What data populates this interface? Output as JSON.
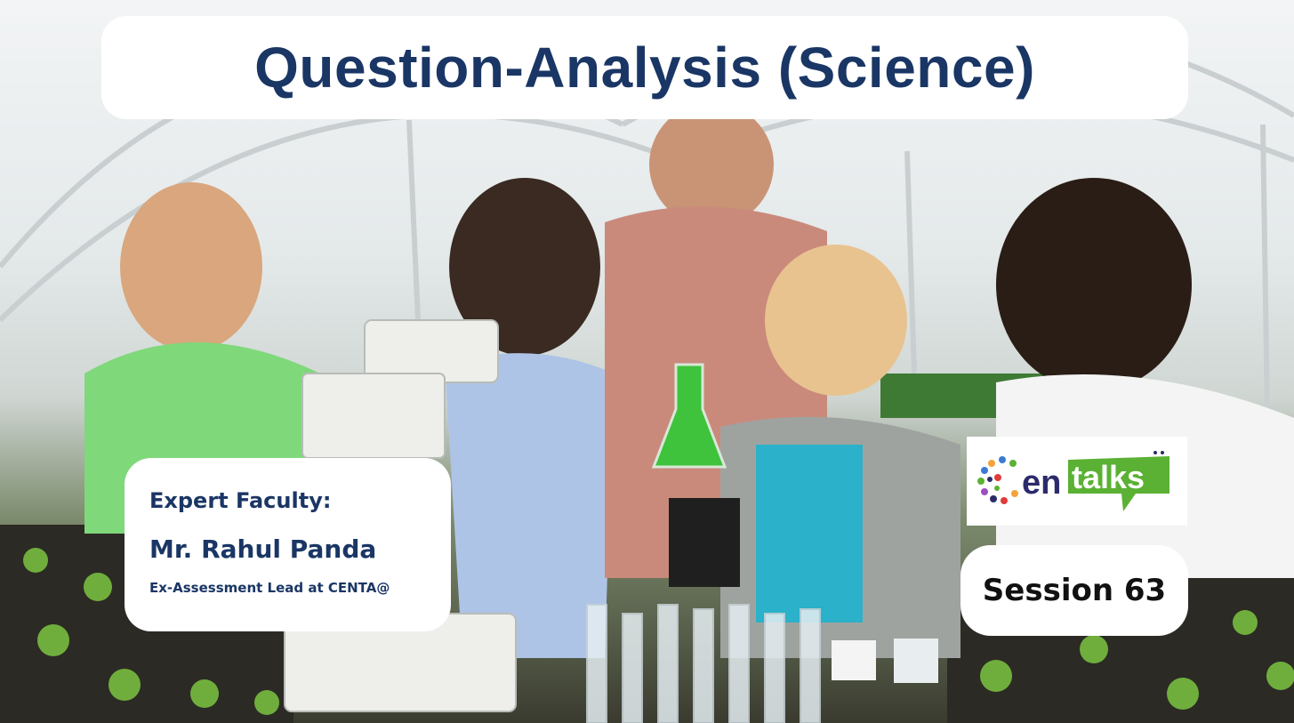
{
  "title": "Question-Analysis (Science)",
  "faculty": {
    "label": "Expert Faculty:",
    "name": "Mr. Rahul Panda",
    "role": "Ex-Assessment Lead at CENTA@"
  },
  "logo": {
    "text": "centalks",
    "icon": "centa-logo"
  },
  "session": "Session 63",
  "colors": {
    "title_text": "#1a3665",
    "logo_green": "#5ab133",
    "logo_text": "#2b2b6b"
  },
  "background": {
    "icon": "greenhouse-photo"
  }
}
